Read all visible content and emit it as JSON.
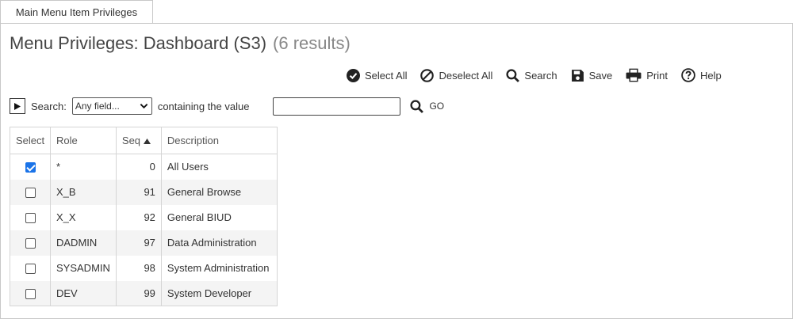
{
  "tab": {
    "label": "Main Menu Item Privileges"
  },
  "page": {
    "title": "Menu Privileges: Dashboard (S3)",
    "result_count": "(6 results)"
  },
  "toolbar": {
    "select_all": "Select All",
    "deselect_all": "Deselect All",
    "search": "Search",
    "save": "Save",
    "print": "Print",
    "help": "Help"
  },
  "search": {
    "label": "Search:",
    "field_selected": "Any field...",
    "containing_label": "containing the value",
    "value": "",
    "go_label": "GO"
  },
  "table": {
    "headers": {
      "select": "Select",
      "role": "Role",
      "seq": "Seq",
      "description": "Description"
    },
    "sort": {
      "column": "seq",
      "direction": "ascending"
    },
    "rows": [
      {
        "selected": true,
        "role": "*",
        "seq": "0",
        "description": "All Users"
      },
      {
        "selected": false,
        "role": "X_B",
        "seq": "91",
        "description": "General Browse"
      },
      {
        "selected": false,
        "role": "X_X",
        "seq": "92",
        "description": "General BIUD"
      },
      {
        "selected": false,
        "role": "DADMIN",
        "seq": "97",
        "description": "Data Administration"
      },
      {
        "selected": false,
        "role": "SYSADMIN",
        "seq": "98",
        "description": "System Administration"
      },
      {
        "selected": false,
        "role": "DEV",
        "seq": "99",
        "description": "System Developer"
      }
    ]
  },
  "colors": {
    "checkbox_checked": "#1a73e8",
    "border": "#c8c8c8",
    "row_alt": "#f4f4f4"
  }
}
